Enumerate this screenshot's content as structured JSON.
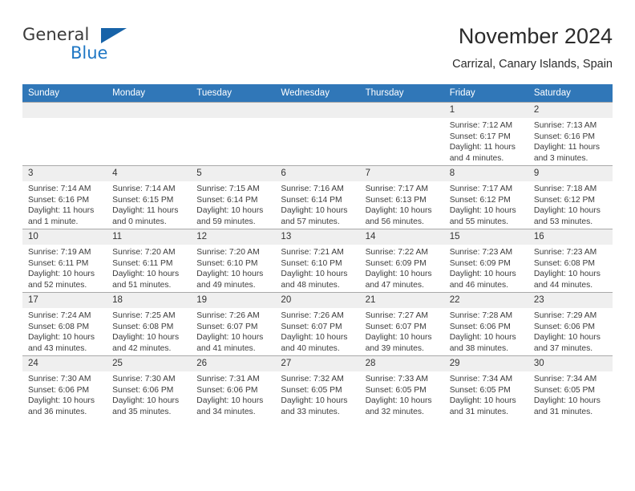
{
  "brand": {
    "word_one": "General",
    "word_two": "Blue",
    "flag_icon": "triangle-flag-icon"
  },
  "header": {
    "title": "November 2024",
    "subtitle": "Carrizal, Canary Islands, Spain"
  },
  "colors": {
    "header_blue": "#3077b8",
    "brand_blue": "#1f77c4",
    "daynum_bg": "#efefef",
    "grid_line": "#a9a9a9"
  },
  "weekdays": [
    "Sunday",
    "Monday",
    "Tuesday",
    "Wednesday",
    "Thursday",
    "Friday",
    "Saturday"
  ],
  "weeks": [
    [
      {
        "day": "",
        "sunrise": "",
        "sunset": "",
        "daylight": "",
        "blank": true
      },
      {
        "day": "",
        "sunrise": "",
        "sunset": "",
        "daylight": "",
        "blank": true
      },
      {
        "day": "",
        "sunrise": "",
        "sunset": "",
        "daylight": "",
        "blank": true
      },
      {
        "day": "",
        "sunrise": "",
        "sunset": "",
        "daylight": "",
        "blank": true
      },
      {
        "day": "",
        "sunrise": "",
        "sunset": "",
        "daylight": "",
        "blank": true
      },
      {
        "day": "1",
        "sunrise": "Sunrise: 7:12 AM",
        "sunset": "Sunset: 6:17 PM",
        "daylight": "Daylight: 11 hours and 4 minutes."
      },
      {
        "day": "2",
        "sunrise": "Sunrise: 7:13 AM",
        "sunset": "Sunset: 6:16 PM",
        "daylight": "Daylight: 11 hours and 3 minutes."
      }
    ],
    [
      {
        "day": "3",
        "sunrise": "Sunrise: 7:14 AM",
        "sunset": "Sunset: 6:16 PM",
        "daylight": "Daylight: 11 hours and 1 minute."
      },
      {
        "day": "4",
        "sunrise": "Sunrise: 7:14 AM",
        "sunset": "Sunset: 6:15 PM",
        "daylight": "Daylight: 11 hours and 0 minutes."
      },
      {
        "day": "5",
        "sunrise": "Sunrise: 7:15 AM",
        "sunset": "Sunset: 6:14 PM",
        "daylight": "Daylight: 10 hours and 59 minutes."
      },
      {
        "day": "6",
        "sunrise": "Sunrise: 7:16 AM",
        "sunset": "Sunset: 6:14 PM",
        "daylight": "Daylight: 10 hours and 57 minutes."
      },
      {
        "day": "7",
        "sunrise": "Sunrise: 7:17 AM",
        "sunset": "Sunset: 6:13 PM",
        "daylight": "Daylight: 10 hours and 56 minutes."
      },
      {
        "day": "8",
        "sunrise": "Sunrise: 7:17 AM",
        "sunset": "Sunset: 6:12 PM",
        "daylight": "Daylight: 10 hours and 55 minutes."
      },
      {
        "day": "9",
        "sunrise": "Sunrise: 7:18 AM",
        "sunset": "Sunset: 6:12 PM",
        "daylight": "Daylight: 10 hours and 53 minutes."
      }
    ],
    [
      {
        "day": "10",
        "sunrise": "Sunrise: 7:19 AM",
        "sunset": "Sunset: 6:11 PM",
        "daylight": "Daylight: 10 hours and 52 minutes."
      },
      {
        "day": "11",
        "sunrise": "Sunrise: 7:20 AM",
        "sunset": "Sunset: 6:11 PM",
        "daylight": "Daylight: 10 hours and 51 minutes."
      },
      {
        "day": "12",
        "sunrise": "Sunrise: 7:20 AM",
        "sunset": "Sunset: 6:10 PM",
        "daylight": "Daylight: 10 hours and 49 minutes."
      },
      {
        "day": "13",
        "sunrise": "Sunrise: 7:21 AM",
        "sunset": "Sunset: 6:10 PM",
        "daylight": "Daylight: 10 hours and 48 minutes."
      },
      {
        "day": "14",
        "sunrise": "Sunrise: 7:22 AM",
        "sunset": "Sunset: 6:09 PM",
        "daylight": "Daylight: 10 hours and 47 minutes."
      },
      {
        "day": "15",
        "sunrise": "Sunrise: 7:23 AM",
        "sunset": "Sunset: 6:09 PM",
        "daylight": "Daylight: 10 hours and 46 minutes."
      },
      {
        "day": "16",
        "sunrise": "Sunrise: 7:23 AM",
        "sunset": "Sunset: 6:08 PM",
        "daylight": "Daylight: 10 hours and 44 minutes."
      }
    ],
    [
      {
        "day": "17",
        "sunrise": "Sunrise: 7:24 AM",
        "sunset": "Sunset: 6:08 PM",
        "daylight": "Daylight: 10 hours and 43 minutes."
      },
      {
        "day": "18",
        "sunrise": "Sunrise: 7:25 AM",
        "sunset": "Sunset: 6:08 PM",
        "daylight": "Daylight: 10 hours and 42 minutes."
      },
      {
        "day": "19",
        "sunrise": "Sunrise: 7:26 AM",
        "sunset": "Sunset: 6:07 PM",
        "daylight": "Daylight: 10 hours and 41 minutes."
      },
      {
        "day": "20",
        "sunrise": "Sunrise: 7:26 AM",
        "sunset": "Sunset: 6:07 PM",
        "daylight": "Daylight: 10 hours and 40 minutes."
      },
      {
        "day": "21",
        "sunrise": "Sunrise: 7:27 AM",
        "sunset": "Sunset: 6:07 PM",
        "daylight": "Daylight: 10 hours and 39 minutes."
      },
      {
        "day": "22",
        "sunrise": "Sunrise: 7:28 AM",
        "sunset": "Sunset: 6:06 PM",
        "daylight": "Daylight: 10 hours and 38 minutes."
      },
      {
        "day": "23",
        "sunrise": "Sunrise: 7:29 AM",
        "sunset": "Sunset: 6:06 PM",
        "daylight": "Daylight: 10 hours and 37 minutes."
      }
    ],
    [
      {
        "day": "24",
        "sunrise": "Sunrise: 7:30 AM",
        "sunset": "Sunset: 6:06 PM",
        "daylight": "Daylight: 10 hours and 36 minutes."
      },
      {
        "day": "25",
        "sunrise": "Sunrise: 7:30 AM",
        "sunset": "Sunset: 6:06 PM",
        "daylight": "Daylight: 10 hours and 35 minutes."
      },
      {
        "day": "26",
        "sunrise": "Sunrise: 7:31 AM",
        "sunset": "Sunset: 6:06 PM",
        "daylight": "Daylight: 10 hours and 34 minutes."
      },
      {
        "day": "27",
        "sunrise": "Sunrise: 7:32 AM",
        "sunset": "Sunset: 6:05 PM",
        "daylight": "Daylight: 10 hours and 33 minutes."
      },
      {
        "day": "28",
        "sunrise": "Sunrise: 7:33 AM",
        "sunset": "Sunset: 6:05 PM",
        "daylight": "Daylight: 10 hours and 32 minutes."
      },
      {
        "day": "29",
        "sunrise": "Sunrise: 7:34 AM",
        "sunset": "Sunset: 6:05 PM",
        "daylight": "Daylight: 10 hours and 31 minutes."
      },
      {
        "day": "30",
        "sunrise": "Sunrise: 7:34 AM",
        "sunset": "Sunset: 6:05 PM",
        "daylight": "Daylight: 10 hours and 31 minutes."
      }
    ]
  ]
}
